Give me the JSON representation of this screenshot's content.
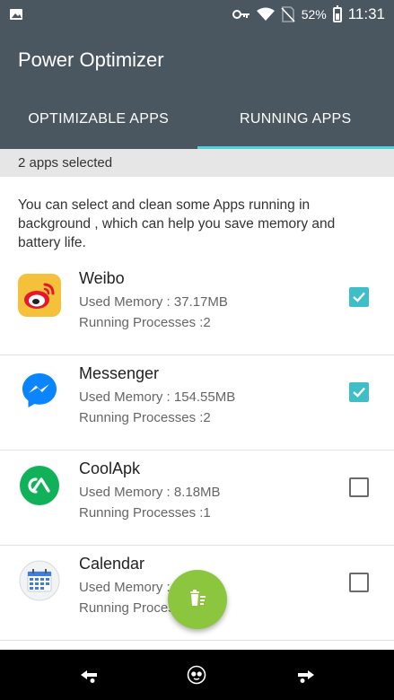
{
  "status_bar": {
    "battery_percent": "52%",
    "time": "11:31"
  },
  "app_bar": {
    "title": "Power Optimizer"
  },
  "tabs": [
    {
      "label": "OPTIMIZABLE APPS",
      "active": false
    },
    {
      "label": "RUNNING APPS",
      "active": true
    }
  ],
  "selection": {
    "text": "2 apps selected"
  },
  "description": "You can select and clean some Apps running in background , which can help you save memory and battery life.",
  "apps": [
    {
      "name": "Weibo",
      "memory": "Used Memory : 37.17MB",
      "processes": "Running Processes :2",
      "checked": true,
      "icon": "weibo-icon"
    },
    {
      "name": "Messenger",
      "memory": "Used Memory : 154.55MB",
      "processes": "Running Processes :2",
      "checked": true,
      "icon": "messenger-icon"
    },
    {
      "name": "CoolApk",
      "memory": "Used Memory : 8.18MB",
      "processes": "Running Processes :1",
      "checked": false,
      "icon": "coolapk-icon"
    },
    {
      "name": "Calendar",
      "memory": "Used Memory : ...MB",
      "processes": "Running Processes",
      "checked": false,
      "icon": "calendar-icon"
    }
  ],
  "colors": {
    "bar": "#4a5760",
    "accent": "#53d3d8",
    "checkbox": "#3ebec6",
    "fab": "#8cc63e"
  },
  "fab": {
    "icon": "trash-icon"
  },
  "nav": {
    "icons": [
      "back-nav-icon",
      "home-nav-icon",
      "recents-nav-icon"
    ]
  }
}
